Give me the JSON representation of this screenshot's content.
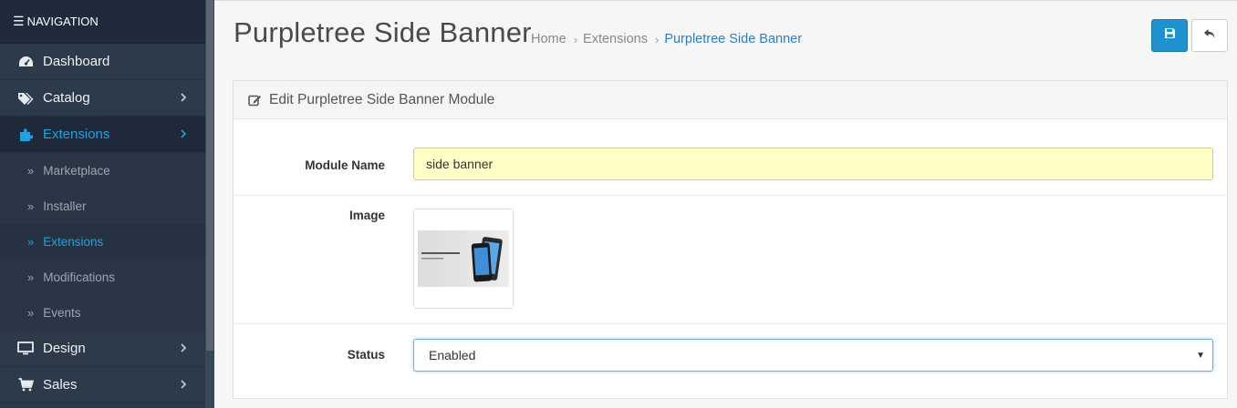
{
  "sidebar": {
    "header": "NAVIGATION",
    "items": [
      {
        "label": "Dashboard",
        "icon": "dashboard-icon"
      },
      {
        "label": "Catalog",
        "icon": "tags-icon"
      },
      {
        "label": "Extensions",
        "icon": "puzzle-icon"
      },
      {
        "label": "Design",
        "icon": "monitor-icon"
      },
      {
        "label": "Sales",
        "icon": "cart-icon"
      }
    ],
    "submenu": [
      {
        "label": "Marketplace"
      },
      {
        "label": "Installer"
      },
      {
        "label": "Extensions"
      },
      {
        "label": "Modifications"
      },
      {
        "label": "Events"
      }
    ]
  },
  "page": {
    "title": "Purpletree Side Banner",
    "breadcrumb": [
      "Home",
      "Extensions",
      "Purpletree Side Banner"
    ]
  },
  "panel": {
    "heading": "Edit Purpletree Side Banner Module",
    "fields": {
      "module_name_label": "Module Name",
      "module_name_value": "side banner",
      "image_label": "Image",
      "status_label": "Status",
      "status_value": "Enabled"
    }
  },
  "colors": {
    "accent": "#1e91cf",
    "sidebar_bg": "#2d3a4a",
    "active_link": "#1ea2e0"
  }
}
